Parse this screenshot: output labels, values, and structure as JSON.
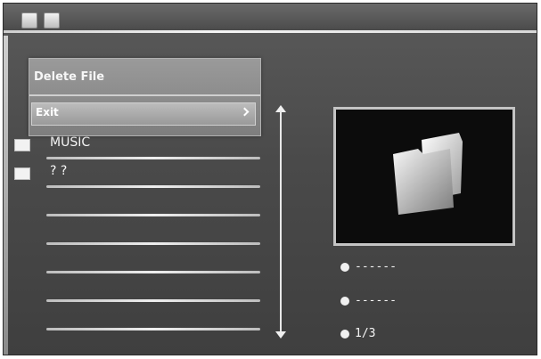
{
  "dialog": {
    "title": "Delete File",
    "option": "Exit"
  },
  "file_list": [
    {
      "label": "MUSIC"
    },
    {
      "label": "? ?"
    },
    {
      "label": ""
    },
    {
      "label": ""
    },
    {
      "label": ""
    },
    {
      "label": ""
    },
    {
      "label": ""
    }
  ],
  "info": {
    "line1": "------",
    "line2": "------",
    "page": "1/3"
  },
  "colors": {
    "background": "#4a4a4a",
    "text": "#f6f6f6",
    "preview_bg": "#0c0c0c"
  }
}
